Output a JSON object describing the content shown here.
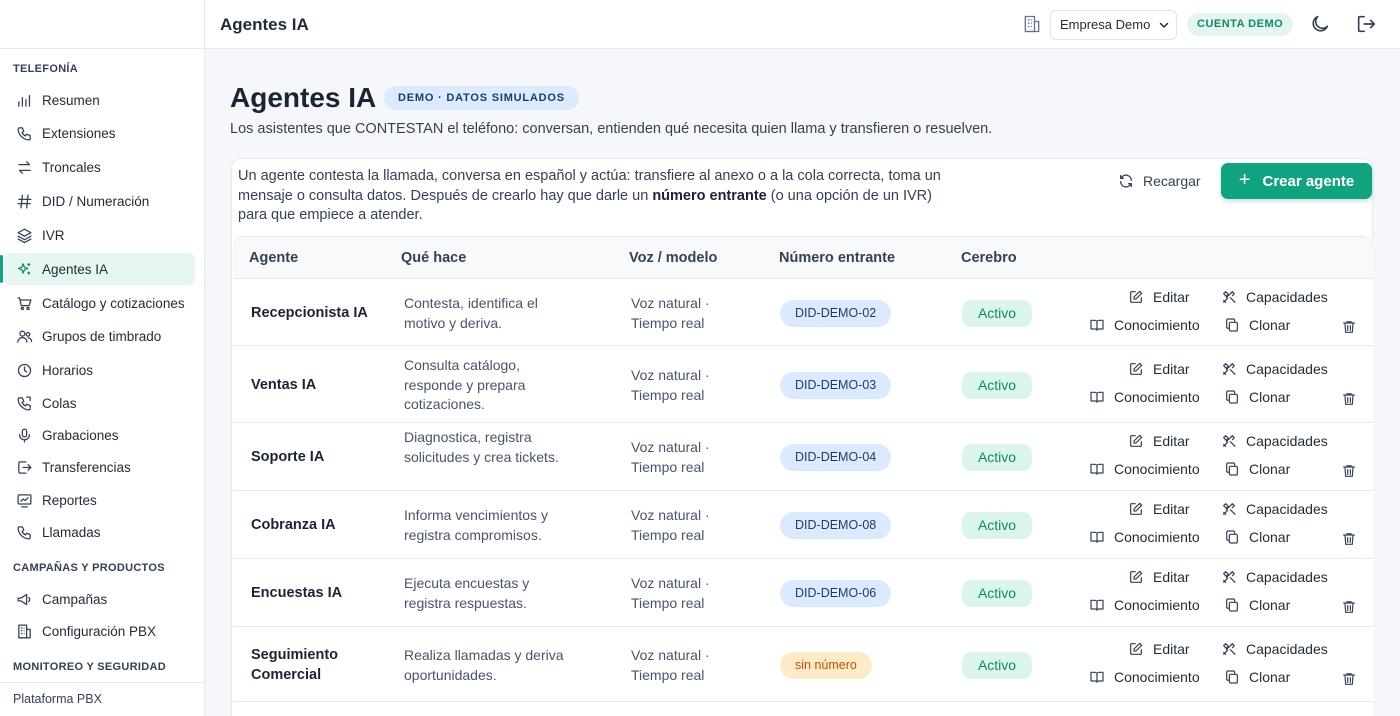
{
  "topbar": {
    "title": "Agentes IA",
    "company": "Empresa Demo",
    "account_badge": "CUENTA DEMO"
  },
  "sidebar": {
    "sections": [
      {
        "label": "TELEFONÍA"
      },
      {
        "label": "CAMPAÑAS Y PRODUCTOS"
      },
      {
        "label": "MONITOREO Y SEGURIDAD"
      }
    ],
    "items": [
      {
        "label": "Resumen",
        "icon": "bar-chart-icon"
      },
      {
        "label": "Extensiones",
        "icon": "phone-icon"
      },
      {
        "label": "Troncales",
        "icon": "arrows-swap-icon"
      },
      {
        "label": "DID / Numeración",
        "icon": "hash-icon"
      },
      {
        "label": "IVR",
        "icon": "layers-icon"
      },
      {
        "label": "Agentes IA",
        "icon": "sparkles-icon",
        "active": true
      },
      {
        "label": "Catálogo y cotizaciones",
        "icon": "cart-icon"
      },
      {
        "label": "Grupos de timbrado",
        "icon": "users-icon"
      },
      {
        "label": "Horarios",
        "icon": "clock-icon"
      },
      {
        "label": "Colas",
        "icon": "phone-queue-icon"
      },
      {
        "label": "Grabaciones",
        "icon": "microphone-icon"
      },
      {
        "label": "Transferencias",
        "icon": "transfer-icon"
      },
      {
        "label": "Reportes",
        "icon": "report-icon"
      },
      {
        "label": "Llamadas",
        "icon": "call-icon"
      },
      {
        "label": "Campañas",
        "icon": "megaphone-icon"
      },
      {
        "label": "Configuración PBX",
        "icon": "building-icon"
      }
    ],
    "footer": "Plataforma PBX"
  },
  "page": {
    "title": "Agentes IA",
    "demo_pill": "DEMO · DATOS SIMULADOS",
    "subtitle": "Los asistentes que CONTESTAN el teléfono: conversan, entienden qué necesita quien llama y transfieren o resuelven.",
    "intro_before": "Un agente contesta la llamada, conversa en español y actúa: transfiere al anexo o a la cola correcta, toma un mensaje o consulta datos. Después de crearlo hay que darle un ",
    "intro_bold": "número entrante",
    "intro_after": " (o una opción de un IVR) para que empiece a atender.",
    "reload_label": "Recargar",
    "create_label": "Crear agente",
    "accent_color": "#11a37f"
  },
  "table": {
    "columns": [
      "Agente",
      "Qué hace",
      "Voz / modelo",
      "Número entrante",
      "Cerebro"
    ],
    "actions": {
      "edit": "Editar",
      "capabilities": "Capacidades",
      "knowledge": "Conocimiento",
      "clone": "Clonar"
    },
    "rows": [
      {
        "name": "Recepcionista IA",
        "desc": "Contesta, identifica el motivo y deriva.",
        "voice": "Voz natural · Tiempo real",
        "did": "DID-DEMO-02",
        "status": "Activo"
      },
      {
        "name": "Ventas IA",
        "desc": "Consulta catálogo, responde y prepara cotizaciones.",
        "voice": "Voz natural · Tiempo real",
        "did": "DID-DEMO-03",
        "status": "Activo"
      },
      {
        "name": "Soporte IA",
        "desc": "Diagnostica, registra solicitudes y crea tickets.",
        "voice": "Voz natural · Tiempo real",
        "did": "DID-DEMO-04",
        "status": "Activo"
      },
      {
        "name": "Cobranza IA",
        "desc": "Informa vencimientos y registra compromisos.",
        "voice": "Voz natural · Tiempo real",
        "did": "DID-DEMO-08",
        "status": "Activo"
      },
      {
        "name": "Encuestas IA",
        "desc": "Ejecuta encuestas y registra respuestas.",
        "voice": "Voz natural · Tiempo real",
        "did": "DID-DEMO-06",
        "status": "Activo"
      },
      {
        "name": "Seguimiento Comercial",
        "desc": "Realiza llamadas y deriva oportunidades.",
        "voice": "Voz natural · Tiempo real",
        "did": "sin número",
        "did_missing": true,
        "status": "Activo"
      }
    ]
  }
}
